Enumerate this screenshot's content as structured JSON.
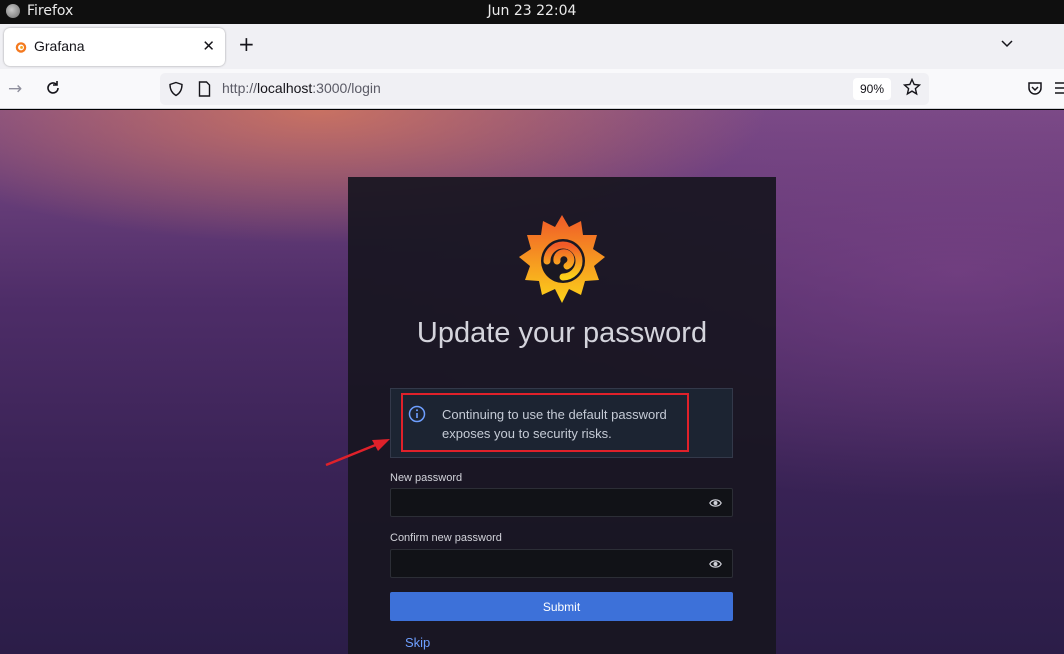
{
  "os": {
    "app_name": "Firefox",
    "clock": "Jun 23  22:04"
  },
  "browser": {
    "tab_title": "Grafana",
    "url_prefix": "http://",
    "url_host": "localhost",
    "url_rest": ":3000/login",
    "zoom": "90%"
  },
  "page": {
    "heading": "Update your password",
    "alert_message": "Continuing to use the default password exposes you to security risks.",
    "new_password_label": "New password",
    "confirm_password_label": "Confirm new password",
    "submit_label": "Submit",
    "skip_label": "Skip"
  },
  "colors": {
    "accent": "#3d71d9",
    "annotation": "#e0212a",
    "link": "#6e9fff"
  }
}
